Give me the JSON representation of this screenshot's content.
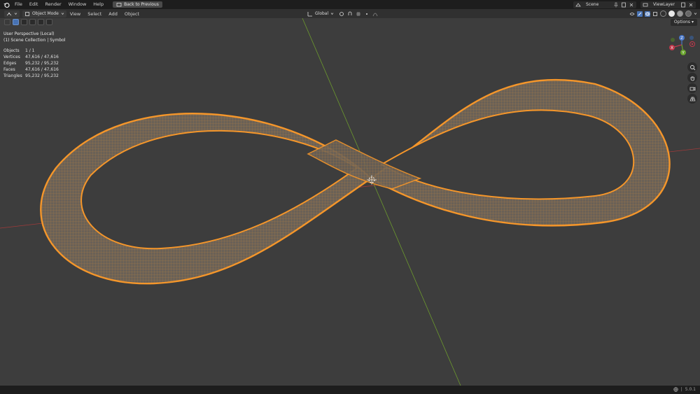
{
  "menubar": {
    "items": [
      "File",
      "Edit",
      "Render",
      "Window",
      "Help"
    ],
    "back_button": "Back to Previous",
    "scene": "Scene",
    "view_layer": "ViewLayer"
  },
  "header": {
    "mode": "Object Mode",
    "menus": [
      "View",
      "Select",
      "Add",
      "Object"
    ],
    "transform_orientation": "Global"
  },
  "toolbar": {
    "options_label": "Options"
  },
  "viewport": {
    "perspective": "User Perspective (Local)",
    "collection": "(1) Scene Collection | Symbol",
    "stats": [
      {
        "label": "Objects",
        "value": "1 / 1"
      },
      {
        "label": "Vertices",
        "value": "47,616 / 47,616"
      },
      {
        "label": "Edges",
        "value": "95,232 / 95,232"
      },
      {
        "label": "Faces",
        "value": "47,616 / 47,616"
      },
      {
        "label": "Triangles",
        "value": "95,232 / 95,232"
      }
    ],
    "gizmo": {
      "z": "Z",
      "x": "X",
      "y": "Y"
    },
    "colors": {
      "selection": "#f5962a",
      "x_axis": "#a03a3a",
      "y_axis": "#6c9a2e",
      "background": "#3d3d3d"
    }
  },
  "statusbar": {
    "version": "5.0.1"
  }
}
